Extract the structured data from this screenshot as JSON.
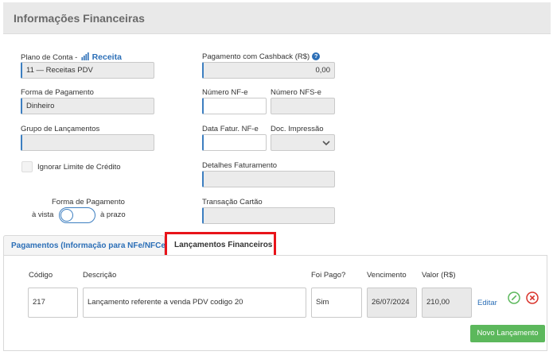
{
  "header": {
    "title": "Informações Financeiras"
  },
  "left": {
    "plano_conta_label": "Plano de Conta -",
    "plano_conta_link": "Receita",
    "plano_conta_value": "11 — Receitas PDV",
    "forma_pagamento_label": "Forma de Pagamento",
    "forma_pagamento_value": "Dinheiro",
    "grupo_label": "Grupo de Lançamentos",
    "grupo_value": "",
    "ignorar_limite_label": "Ignorar Limite de Crédito",
    "toggle_title": "Forma de Pagamento",
    "toggle_left": "à vista",
    "toggle_right": "à prazo"
  },
  "right": {
    "cashback_label": "Pagamento com Cashback (R$)",
    "cashback_value": "0,00",
    "nfe_label": "Número NF-e",
    "nfse_label": "Número NFS-e",
    "data_fatur_label": "Data Fatur. NF-e",
    "doc_impressao_label": "Doc. Impressão",
    "detalhes_label": "Detalhes Faturamento",
    "transacao_label": "Transação Cartão",
    "help_glyph": "?"
  },
  "tabs": [
    {
      "label": "Pagamentos (Informação para NFe/NFCe)"
    },
    {
      "label": "Lançamentos Financeiros"
    }
  ],
  "table": {
    "headers": {
      "codigo": "Código",
      "descricao": "Descrição",
      "foi_pago": "Foi Pago?",
      "vencimento": "Vencimento",
      "valor": "Valor (R$)"
    },
    "rows": [
      {
        "codigo": "217",
        "descricao": "Lançamento referente a venda PDV codigo 20",
        "foi_pago": "Sim",
        "vencimento": "26/07/2024",
        "valor": "210,00",
        "edit_label": "Editar"
      }
    ],
    "new_button": "Novo Lançamento"
  },
  "colors": {
    "accent_blue": "#2c6fb7",
    "highlight_red": "#e8141a",
    "success_green": "#5cb85c",
    "delete_red": "#d9332b"
  },
  "icons": [
    "chart-icon",
    "help-icon",
    "chevron-down-icon",
    "check-circle-icon",
    "delete-circle-icon"
  ]
}
